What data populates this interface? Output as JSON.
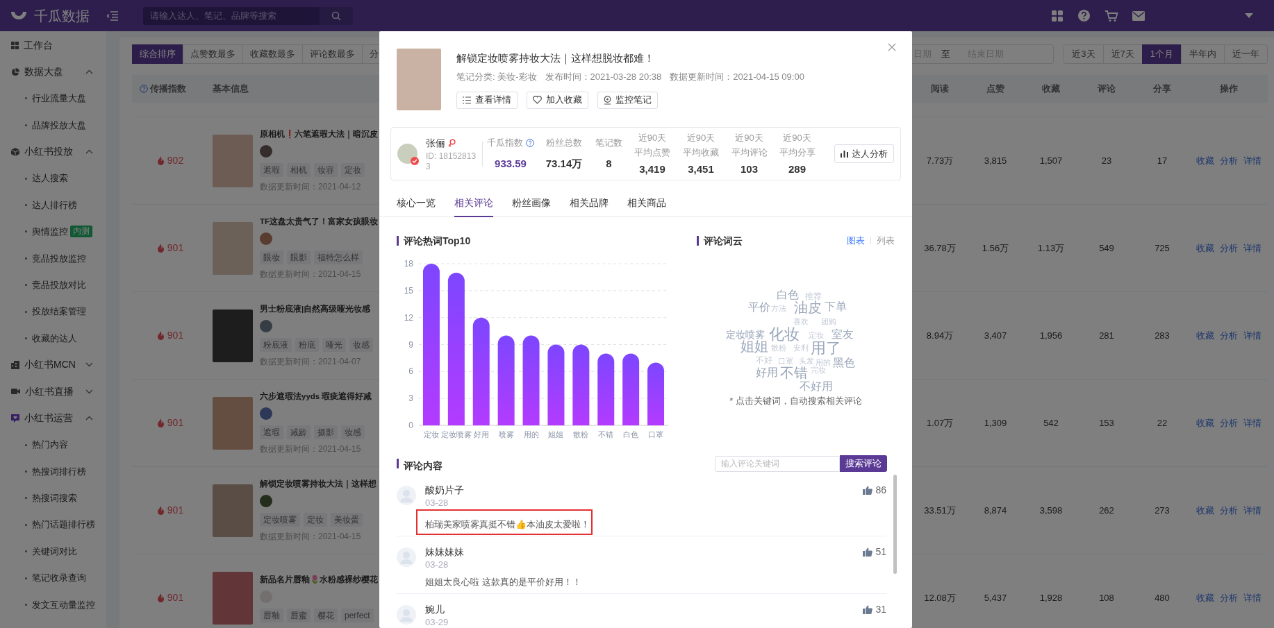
{
  "app": {
    "logo_text": "千瓜数据",
    "search": {
      "placeholder": "请输入达人、笔记、品牌等搜索"
    }
  },
  "sidebar": {
    "items": [
      {
        "label": "工作台",
        "kind": "link"
      },
      {
        "label": "数据大盘",
        "kind": "group",
        "active": false,
        "expanded": true,
        "children": [
          {
            "label": "行业流量大盘"
          },
          {
            "label": "品牌投放大盘"
          }
        ]
      },
      {
        "label": "小红书投放",
        "kind": "group",
        "active": false,
        "expanded": true,
        "children": [
          {
            "label": "达人搜索"
          },
          {
            "label": "达人排行榜"
          },
          {
            "label": "舆情监控",
            "badge": "内测"
          },
          {
            "label": "竞品投放监控"
          },
          {
            "label": "竞品投放对比"
          },
          {
            "label": "投放结案管理"
          },
          {
            "label": "收藏的达人"
          }
        ]
      },
      {
        "label": "小红书MCN",
        "kind": "group",
        "active": false,
        "expanded": false
      },
      {
        "label": "小红书直播",
        "kind": "group",
        "active": false,
        "expanded": false
      },
      {
        "label": "小红书运营",
        "kind": "group",
        "active": true,
        "expanded": true,
        "children": [
          {
            "label": "热门内容"
          },
          {
            "label": "热搜词排行榜"
          },
          {
            "label": "热搜词搜索"
          },
          {
            "label": "热门话题排行榜"
          },
          {
            "label": "关键词对比"
          },
          {
            "label": "笔记收录查询"
          },
          {
            "label": "发文互动量监控"
          }
        ]
      }
    ]
  },
  "sort_tabs": [
    {
      "label": "综合排序",
      "selected": true
    },
    {
      "label": "点赞数最多",
      "selected": false
    },
    {
      "label": "收藏数最多",
      "selected": false
    },
    {
      "label": "评论数最多",
      "selected": false
    },
    {
      "label": "分",
      "selected": false
    }
  ],
  "date_range": {
    "start": "日期",
    "separator": "至",
    "end": "结束日期"
  },
  "period_buttons": [
    {
      "label": "近3天",
      "selected": false
    },
    {
      "label": "近7天",
      "selected": false
    },
    {
      "label": "1个月",
      "selected": true
    },
    {
      "label": "半年内",
      "selected": false
    },
    {
      "label": "近一年",
      "selected": false
    }
  ],
  "table": {
    "columns": [
      "传播指数",
      "基本信息",
      "阅读",
      "点赞",
      "收藏",
      "评论",
      "分享",
      "操作"
    ],
    "rows": [
      {
        "score": "902",
        "title": "原相机❗六笔遮瑕大法｜暗沉皮",
        "tags": [
          "遮瑕",
          "相机",
          "妆容",
          "定妆"
        ],
        "updated": "数据更新时间：2021-04-12",
        "values": [
          "7.73万",
          "3,815",
          "1,507",
          "23",
          "17"
        ],
        "actions": [
          "收藏",
          "分析",
          "详情"
        ]
      },
      {
        "score": "901",
        "title": "TF这盘太贵气了！富家女孩眼妆",
        "tags": [
          "眼妆",
          "眼影",
          "福特怎么样"
        ],
        "updated": "数据更新时间：2021-04-15",
        "values": [
          "36.78万",
          "1.56万",
          "1.13万",
          "549",
          "725"
        ],
        "actions": [
          "收藏",
          "分析",
          "详情"
        ]
      },
      {
        "score": "901",
        "title": "男士粉底液|自然高级哑光妆感",
        "tags": [
          "粉底液",
          "粉底",
          "哑光",
          "妆感"
        ],
        "updated": "数据更新时间：2021-04-07",
        "values": [
          "8.94万",
          "3,407",
          "1,956",
          "281",
          "283"
        ],
        "actions": [
          "收藏",
          "分析",
          "详情"
        ]
      },
      {
        "score": "901",
        "title": "六步遮瑕法yyds 瑕疵遮得好减",
        "tags": [
          "遮瑕",
          "减龄",
          "摄影",
          "妆感"
        ],
        "updated": "数据更新时间：2021-04-15",
        "values": [
          "1.07万",
          "1,309",
          "542",
          "153",
          "22"
        ],
        "actions": [
          "收藏",
          "分析",
          "详情"
        ]
      },
      {
        "score": "901",
        "title": "解锁定妆喷雾持妆大法｜这样想",
        "tags": [
          "定妆喷雾",
          "定妆",
          "美妆蛋"
        ],
        "updated": "数据更新时间：2021-04-15",
        "values": [
          "33.51万",
          "8,874",
          "3,598",
          "262",
          "273"
        ],
        "actions": [
          "收藏",
          "分析",
          "详情"
        ]
      },
      {
        "score": "901",
        "title": "新品名片唇釉🌷水粉感裸纱樱花",
        "tags": [
          "唇釉",
          "唇蜜",
          "樱花",
          "perfect"
        ],
        "values": [
          "12.08万",
          "5,437",
          "1,928",
          "108",
          "480"
        ],
        "actions": [
          "收藏",
          "分析",
          "详情"
        ]
      }
    ]
  },
  "modal": {
    "note": {
      "title": "解锁定妆喷雾持妆大法｜这样想脱妆都难！",
      "meta": [
        "笔记分类: 美妆-彩妆",
        "发布时间：2021-03-28 20:38",
        "数据更新时间：2021-04-15 09:00"
      ],
      "buttons": [
        "查看详情",
        "加入收藏",
        "监控笔记"
      ]
    },
    "creator": {
      "name": "张俪",
      "id": "ID: 181528133",
      "stats": [
        {
          "label": "千瓜指数",
          "value": "933.59",
          "kind": "index"
        },
        {
          "label": "粉丝总数",
          "value": "73.14万",
          "kind": "plain"
        },
        {
          "label": "笔记数",
          "value": "8",
          "kind": "plain"
        },
        {
          "period": "近90天",
          "label": "平均点赞",
          "value": "3,419",
          "kind": "plain"
        },
        {
          "period": "近90天",
          "label": "平均收藏",
          "value": "3,451",
          "kind": "plain"
        },
        {
          "period": "近90天",
          "label": "平均评论",
          "value": "103",
          "kind": "plain"
        },
        {
          "period": "近90天",
          "label": "平均分享",
          "value": "289",
          "kind": "plain"
        }
      ],
      "button": "达人分析"
    },
    "tabs": [
      {
        "label": "核心一览",
        "selected": false
      },
      {
        "label": "相关评论",
        "selected": true
      },
      {
        "label": "粉丝画像",
        "selected": false
      },
      {
        "label": "相关品牌",
        "selected": false
      },
      {
        "label": "相关商品",
        "selected": false
      }
    ],
    "hotwords": {
      "title": "评论热词Top10",
      "chart_data": {
        "type": "bar",
        "categories": [
          "定妆",
          "定妆喷雾",
          "好用",
          "喷雾",
          "用的",
          "姐姐",
          "散粉",
          "不错",
          "白色",
          "口罩"
        ],
        "values": [
          18,
          17,
          12,
          10,
          10,
          9,
          9,
          8,
          8,
          7
        ],
        "ylim": [
          0,
          18
        ],
        "yticks": [
          0,
          3,
          6,
          9,
          12,
          15,
          18
        ],
        "grid": true
      }
    },
    "wordcloud": {
      "title": "评论词云",
      "views": [
        {
          "label": "图表",
          "selected": true
        },
        {
          "label": "列表",
          "selected": false
        }
      ],
      "words": [
        "白色",
        "推荐",
        "平价",
        "方法",
        "油皮",
        "下单",
        "喜欢",
        "团购",
        "定妆喷雾",
        "化妆",
        "定妆",
        "室友",
        "姐姐",
        "散粉",
        "安利",
        "用了",
        "不好",
        "口罩",
        "头发",
        "用的",
        "黑色",
        "好用",
        "不错",
        "完妆",
        "不好用"
      ],
      "hint": "* 点击关键词，自动搜索相关评论"
    },
    "comments": {
      "title": "评论内容",
      "search": {
        "placeholder": "输入评论关键词",
        "button": "搜索评论"
      },
      "items": [
        {
          "user": "酸奶片子",
          "date": "03-28",
          "text": "柏瑞美家喷雾真挺不错👍本油皮太爱啦！",
          "likes": "86",
          "highlighted": true
        },
        {
          "user": "妹妹妹妹",
          "date": "03-28",
          "text": "姐姐太良心啦 这款真的是平价好用！！",
          "likes": "51",
          "highlighted": false
        },
        {
          "user": "婉儿",
          "date": "03-29",
          "likes": "31",
          "highlighted": false
        }
      ]
    }
  }
}
